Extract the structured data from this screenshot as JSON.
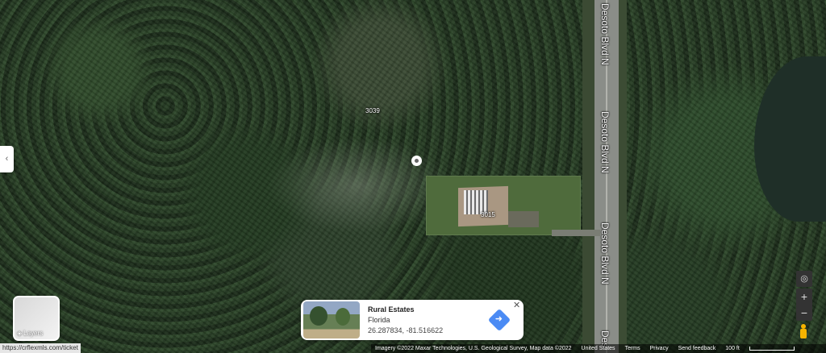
{
  "map": {
    "road_labels": [
      "Desoto Blvd N",
      "Desoto Blvd N",
      "Desoto Blvd N",
      "Des"
    ],
    "address_labels": [
      "3039",
      "3015"
    ]
  },
  "ui": {
    "collapse_icon": "‹",
    "layers_label": "Layers",
    "url_text": "https://crflexmls.com/ticket"
  },
  "place_card": {
    "title": "Rural Estates",
    "subtitle": "Florida",
    "coordinates": "26.287834, -81.516622",
    "close_icon": "✕",
    "directions_icon": "➜"
  },
  "controls": {
    "location_icon": "◎",
    "zoom_in": "+",
    "zoom_out": "−"
  },
  "footer": {
    "attribution": "Imagery ©2022 Maxar Technologies, U.S. Geological Survey, Map data ©2022",
    "country": "United States",
    "terms": "Terms",
    "privacy": "Privacy",
    "feedback": "Send feedback",
    "scale": "100 ft"
  }
}
